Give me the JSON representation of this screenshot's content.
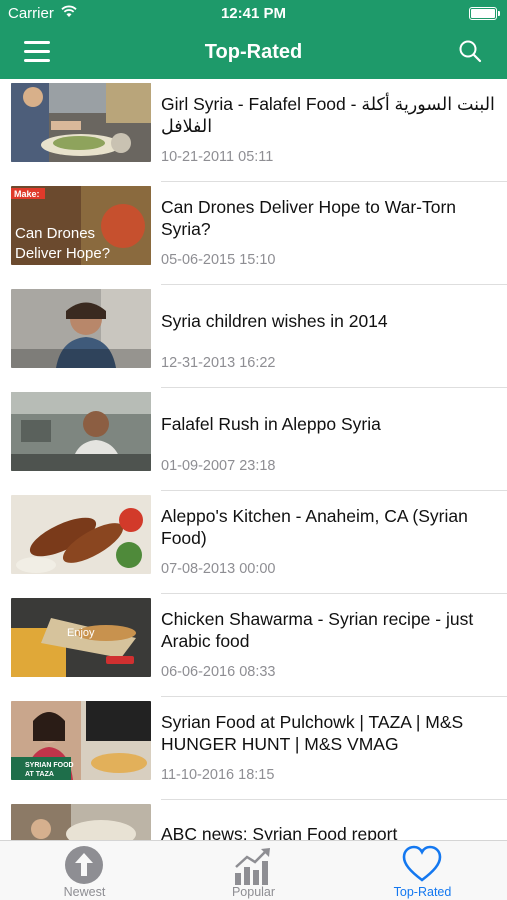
{
  "status_bar": {
    "carrier": "Carrier",
    "time": "12:41 PM",
    "battery_level": 1.0
  },
  "nav": {
    "title": "Top-Rated"
  },
  "videos": [
    {
      "title": "Girl Syria - Falafel Food - البنت السورية أكلة الفلافل",
      "date": "10-21-2011 05:11"
    },
    {
      "title": "Can Drones Deliver Hope to War-Torn Syria?",
      "date": "05-06-2015 15:10",
      "thumb_text": "Can Drones Deliver Hope?",
      "thumb_badge": "Make:"
    },
    {
      "title": "Syria children wishes in 2014",
      "date": "12-31-2013 16:22"
    },
    {
      "title": "Falafel Rush in Aleppo Syria",
      "date": "01-09-2007 23:18"
    },
    {
      "title": "Aleppo's Kitchen - Anaheim, CA (Syrian Food)",
      "date": "07-08-2013 00:00"
    },
    {
      "title": "Chicken Shawarma - Syrian recipe - just Arabic food",
      "date": "06-06-2016 08:33",
      "thumb_text": "Enjoy"
    },
    {
      "title": "Syrian Food at Pulchowk | TAZA | M&S HUNGER HUNT | M&S VMAG",
      "date": "11-10-2016 18:15",
      "thumb_text": "SYRIAN FOOD AT TAZA"
    },
    {
      "title": "ABC news: Syrian Food report",
      "date": ""
    }
  ],
  "tabs": [
    {
      "label": "Newest",
      "icon": "up-arrow-circle-icon",
      "active": false
    },
    {
      "label": "Popular",
      "icon": "bar-chart-trend-icon",
      "active": false
    },
    {
      "label": "Top-Rated",
      "icon": "heart-icon",
      "active": true
    }
  ],
  "colors": {
    "header": "#1e9a6a",
    "active_tab": "#1478f0",
    "inactive_tab": "#8e8e93"
  }
}
